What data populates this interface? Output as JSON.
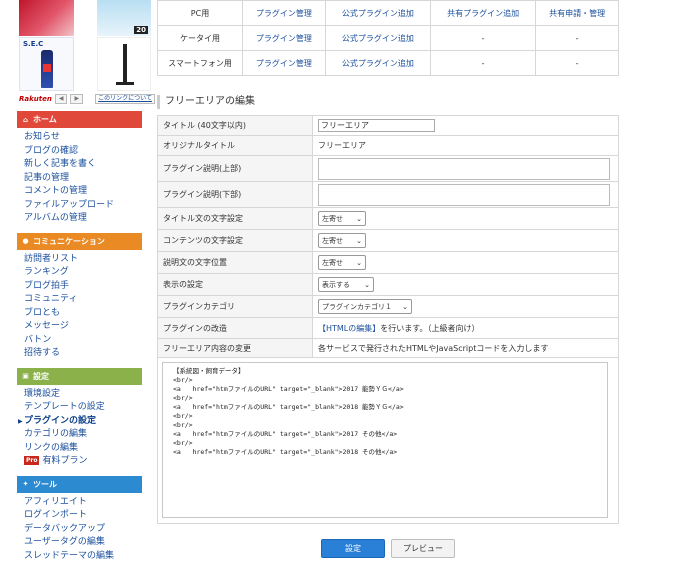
{
  "ads": {
    "bike_tag": "20",
    "sec_label": "S.E.C",
    "rakuten": "Rakuten",
    "prev": "◀",
    "next": "▶",
    "about_link": "このリンクについて"
  },
  "sidebar": {
    "home": {
      "header": "ホーム",
      "icon": "home-icon",
      "items": [
        "お知らせ",
        "ブログの確認",
        "新しく記事を書く",
        "記事の管理",
        "コメントの管理",
        "ファイルアップロード",
        "アルバムの管理"
      ]
    },
    "community": {
      "header": "コミュニケーション",
      "icon": "people-icon",
      "items": [
        "訪問者リスト",
        "ランキング",
        "ブログ拍手",
        "コミュニティ",
        "ブロとも",
        "メッセージ",
        "バトン",
        "招待する"
      ]
    },
    "settings": {
      "header": "設定",
      "icon": "settings-icon",
      "items": [
        "環境設定",
        "テンプレートの設定",
        "プラグインの設定",
        "カテゴリの編集",
        "リンクの編集",
        "有料プラン"
      ],
      "active_index": 2,
      "pro_badge": "Pro"
    },
    "tools": {
      "header": "ツール",
      "icon": "tools-icon",
      "items": [
        "アフィリエイト",
        "ログインポート",
        "データバックアップ",
        "ユーザータグの編集",
        "スレッドテーマの編集"
      ]
    }
  },
  "plugin_table": {
    "rows": [
      {
        "device": "PC用",
        "manage": "プラグイン管理",
        "official": "公式プラグイン追加",
        "shared": "共有プラグイン追加",
        "request": "共有申請・管理"
      },
      {
        "device": "ケータイ用",
        "manage": "プラグイン管理",
        "official": "公式プラグイン追加",
        "shared": "-",
        "request": "-"
      },
      {
        "device": "スマートフォン用",
        "manage": "プラグイン管理",
        "official": "公式プラグイン追加",
        "shared": "-",
        "request": "-"
      }
    ]
  },
  "edit": {
    "section_title": "フリーエリアの編集",
    "title_label": "タイトル (40文字以内)",
    "title_value": "フリーエリア",
    "original_label": "オリジナルタイトル",
    "original_value": "フリーエリア",
    "desc_top_label": "プラグイン説明(上部)",
    "desc_bottom_label": "プラグイン説明(下部)",
    "title_align_label": "タイトル文の文字設定",
    "title_align_value": "左寄せ",
    "content_align_label": "コンテンツの文字設定",
    "content_align_value": "左寄せ",
    "desc_align_label": "説明文の文字位置",
    "desc_align_value": "左寄せ",
    "display_label": "表示の設定",
    "display_value": "表示する",
    "category_label": "プラグインカテゴリ",
    "category_value": "プラグインカテゴリ１",
    "modify_label": "プラグインの改造",
    "modify_link": "【HTMLの編集】",
    "modify_text": "を行います。（上級者向け）",
    "content_label": "フリーエリア内容の変更",
    "content_hint": "各サービスで発行されたHTMLやJavaScriptコードを入力します",
    "code": "【系統図・飼育データ】\n<br/>\n<a   href=\"htmファイルのURL\" target=\"_blank\">2017 能勢ＹＧ</a>\n<br/>\n<a   href=\"htmファイルのURL\" target=\"_blank\">2018 能勢ＹＧ</a>\n<br/>\n<br/>\n<a   href=\"htmファイルのURL\" target=\"_blank\">2017 その他</a>\n<br/>\n<a   href=\"htmファイルのURL\" target=\"_blank\">2018 その他</a>"
  },
  "buttons": {
    "save": "設定",
    "preview": "プレビュー"
  }
}
